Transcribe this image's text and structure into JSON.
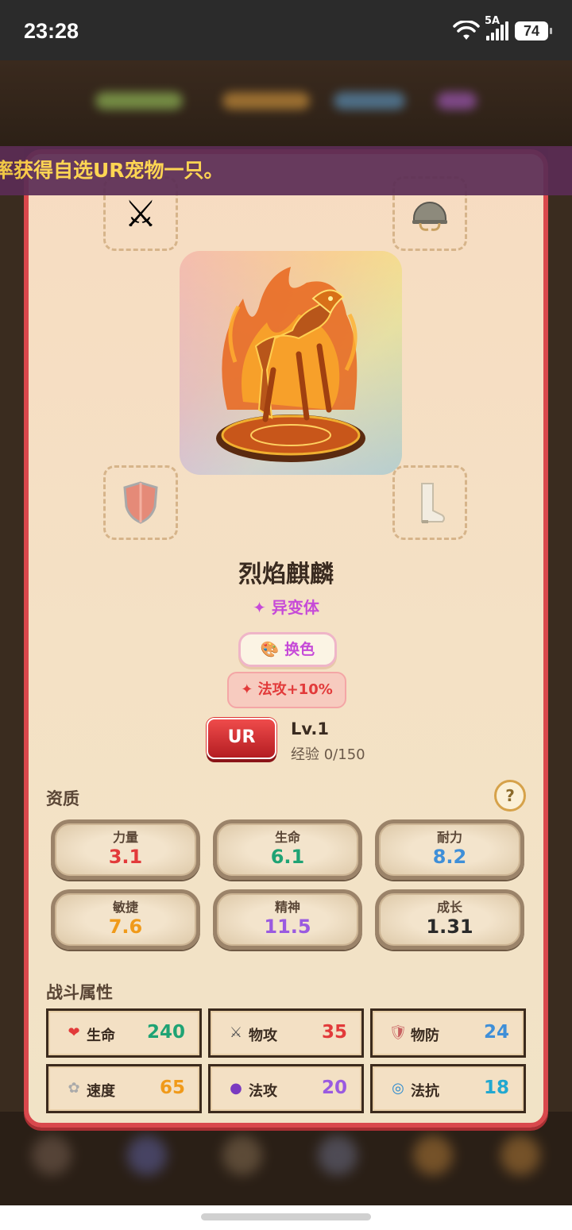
{
  "status_bar": {
    "time": "23:28",
    "network": "5A",
    "battery": "74"
  },
  "banner": {
    "text": "率获得自选UR宠物一只。"
  },
  "equipment_slots": {
    "weapon": "crossed-swords-icon",
    "helmet": "helmet-icon",
    "armor": "shield-icon",
    "boots": "boot-icon"
  },
  "pet": {
    "name": "烈焰麒麟",
    "variant": "✦ 异变体",
    "recolor_label": "换色",
    "bonus_label": "✦ 法攻+10%",
    "rarity": "UR",
    "level": "Lv.1",
    "exp": "经验 0/150"
  },
  "aptitude": {
    "title": "资质",
    "help_label": "?",
    "items": [
      {
        "label": "力量",
        "value": "3.1",
        "color": "#e23a3a"
      },
      {
        "label": "生命",
        "value": "6.1",
        "color": "#1fa374"
      },
      {
        "label": "耐力",
        "value": "8.2",
        "color": "#3f8fd8"
      },
      {
        "label": "敏捷",
        "value": "7.6",
        "color": "#f09a1a"
      },
      {
        "label": "精神",
        "value": "11.5",
        "color": "#9a5ae0"
      },
      {
        "label": "成长",
        "value": "1.31",
        "color": "#2a2a2a"
      }
    ]
  },
  "combat": {
    "title": "战斗属性",
    "items": [
      {
        "icon": "heart-icon",
        "glyph": "❤",
        "label": "生命",
        "value": "240",
        "color": "#1fa374"
      },
      {
        "icon": "sword-icon",
        "glyph": "⚔",
        "label": "物攻",
        "value": "35",
        "color": "#e23a3a"
      },
      {
        "icon": "shield-icon",
        "glyph": "🛡",
        "label": "物防",
        "value": "24",
        "color": "#3f8fd8"
      },
      {
        "icon": "wind-icon",
        "glyph": "✿",
        "label": "速度",
        "value": "65",
        "color": "#f09a1a"
      },
      {
        "icon": "orb-icon",
        "glyph": "●",
        "label": "法攻",
        "value": "20",
        "color": "#9a5ae0"
      },
      {
        "icon": "swirl-icon",
        "glyph": "◎",
        "label": "法抗",
        "value": "18",
        "color": "#22a8d0"
      }
    ]
  }
}
